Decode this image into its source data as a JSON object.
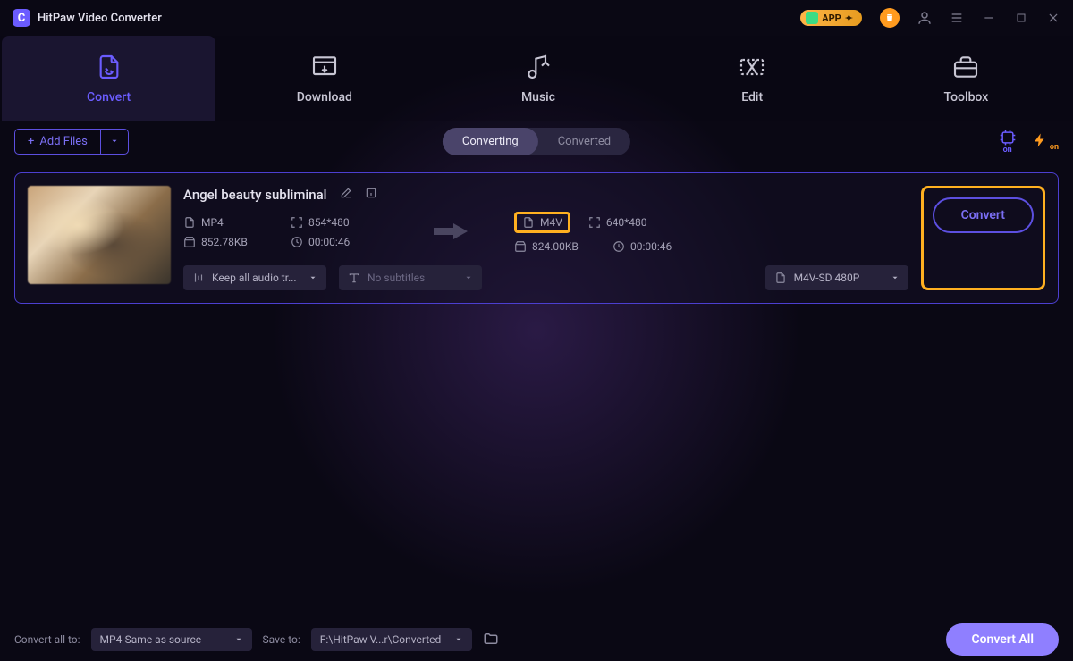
{
  "app": {
    "title": "HitPaw Video Converter",
    "badge": "APP"
  },
  "tabs": [
    {
      "label": "Convert",
      "active": true
    },
    {
      "label": "Download"
    },
    {
      "label": "Music"
    },
    {
      "label": "Edit"
    },
    {
      "label": "Toolbox"
    }
  ],
  "toolbar": {
    "add_files": "Add Files",
    "segments": {
      "converting": "Converting",
      "converted": "Converted"
    },
    "on_label": "on"
  },
  "item": {
    "title": "Angel beauty subliminal",
    "source": {
      "format": "MP4",
      "resolution": "854*480",
      "size": "852.78KB",
      "duration": "00:00:46"
    },
    "target": {
      "format": "M4V",
      "resolution": "640*480",
      "size": "824.00KB",
      "duration": "00:00:46"
    },
    "audio_sel": "Keep all audio tr...",
    "subtitle_sel": "No subtitles",
    "output_sel": "M4V-SD 480P",
    "convert_btn": "Convert"
  },
  "footer": {
    "convert_all_to_label": "Convert all to:",
    "convert_all_to_value": "MP4-Same as source",
    "save_to_label": "Save to:",
    "save_to_value": "F:\\HitPaw V...r\\Converted",
    "convert_all_btn": "Convert All"
  }
}
